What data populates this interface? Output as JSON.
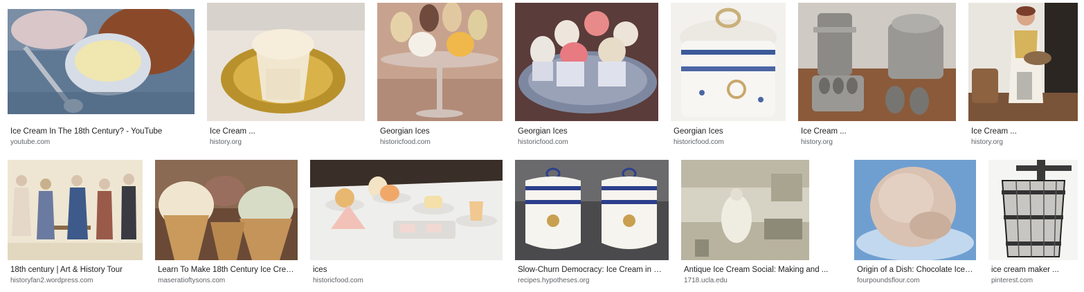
{
  "results": [
    {
      "title": "Ice Cream In The 18th Century? - YouTube",
      "source": "youtube.com"
    },
    {
      "title": "Ice Cream ...",
      "source": "history.org"
    },
    {
      "title": "Georgian Ices",
      "source": "historicfood.com"
    },
    {
      "title": "Georgian Ices",
      "source": "historicfood.com"
    },
    {
      "title": "Georgian Ices",
      "source": "historicfood.com"
    },
    {
      "title": "Ice Cream ...",
      "source": "history.org"
    },
    {
      "title": "Ice Cream ...",
      "source": "history.org"
    },
    {
      "title": "18th century | Art & History Tour",
      "source": "historyfan2.wordpress.com"
    },
    {
      "title": "Learn To Make 18th Century Ice Crea...",
      "source": "maseratioftysons.com"
    },
    {
      "title": "ices",
      "source": "historicfood.com"
    },
    {
      "title": "Slow-Churn Democracy: Ice Cream in 18t...",
      "source": "recipes.hypotheses.org"
    },
    {
      "title": "Antique Ice Cream Social: Making and ...",
      "source": "1718.ucla.edu"
    },
    {
      "title": "Origin of a Dish: Chocolate Ice C...",
      "source": "fourpoundsflour.com"
    },
    {
      "title": "ice cream maker ...",
      "source": "pinterest.com"
    }
  ]
}
